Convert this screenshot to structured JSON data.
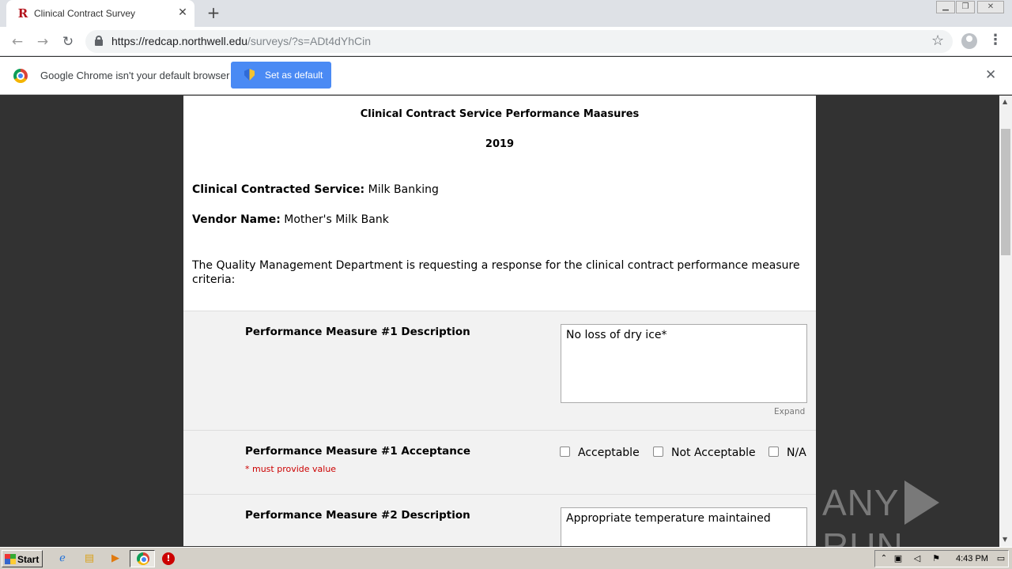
{
  "browser": {
    "tab_title": "Clinical Contract Survey",
    "tab_favicon": "R",
    "new_tab": "+",
    "url_host": "https://redcap.northwell.edu",
    "url_path": "/surveys/?s=ADt4dYhCin",
    "infobar_message": "Google Chrome isn't your default browser",
    "set_default_label": "Set as default"
  },
  "survey": {
    "title": "Clinical Contract Service Performance Maasures",
    "year": "2019",
    "service_label": "Clinical Contracted Service:",
    "service_value": "Milk Banking",
    "vendor_label": "Vendor Name:",
    "vendor_value": "Mother's Milk Bank",
    "request_text": "The Quality Management Department is requesting a response for the clinical contract performance measure criteria:",
    "q1_desc_label": "Performance Measure #1 Description",
    "q1_desc_value": "No loss of dry ice*",
    "expand_label": "Expand",
    "q1_accept_label": "Performance Measure #1 Acceptance",
    "must_provide": "* must provide value",
    "options": [
      "Acceptable",
      "Not Acceptable",
      "N/A"
    ],
    "q2_desc_label": "Performance Measure #2 Description",
    "q2_desc_value": "Appropriate temperature maintained"
  },
  "watermark": {
    "left": "ANY",
    "right": "RUN"
  },
  "taskbar": {
    "start_label": "Start",
    "clock": "4:43 PM"
  }
}
